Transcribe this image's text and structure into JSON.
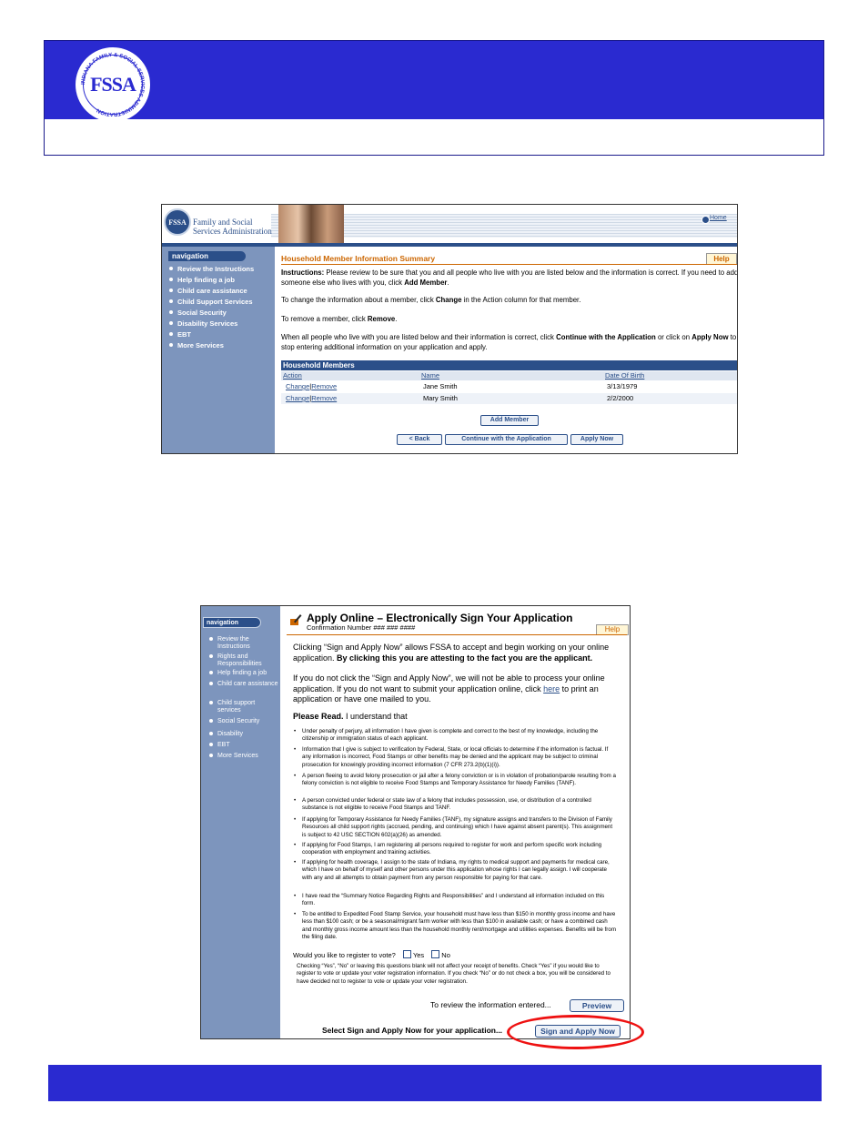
{
  "header": {
    "seal_text": "FSSA",
    "seal_ring": "INDIANA FAMILY & SOCIAL SERVICES ADMINISTRATION"
  },
  "screen1": {
    "org_line1": "Family and Social",
    "org_line2": "Services Administration",
    "home": "Home",
    "nav_label": "navigation",
    "nav_items": [
      "Review the Instructions",
      "Help finding a job",
      "Child care assistance",
      "Child Support Services",
      "Social Security",
      "Disability Services",
      "EBT",
      "More Services"
    ],
    "page_title": "Household Member Information Summary",
    "help": "Help",
    "instr_label": "Instructions:",
    "instr_text": " Please review to be sure that you and all people who live with you are listed below and the information is correct. If you need to add someone else who lives with you, click ",
    "instr_bold": "Add Member",
    "change_pre": "To change the information about a member, click ",
    "change_bold": "Change",
    "change_post": " in the Action column for that member.",
    "remove_pre": "To remove a member, click ",
    "remove_bold": "Remove",
    "continue_pre": "When all people who live with you are listed below and their information is correct, click ",
    "continue_bold": "Continue with the Application",
    "continue_mid": " or click on ",
    "continue_bold2": "Apply Now",
    "continue_post": " to stop entering additional information on your application and apply.",
    "table_title": "Household Members",
    "columns": [
      "Action",
      "Name",
      "Date Of Birth"
    ],
    "rows": [
      {
        "change": "Change",
        "remove": "Remove",
        "name": "Jane Smith",
        "dob": "3/13/1979"
      },
      {
        "change": "Change",
        "remove": "Remove",
        "name": "Mary Smith",
        "dob": "2/2/2000"
      }
    ],
    "add_member": "Add Member",
    "back": "< Back",
    "continue_btn": "Continue with the Application",
    "apply_now": "Apply Now"
  },
  "screen2": {
    "nav_label": "navigation",
    "nav_items": [
      "Review the Instructions",
      "Rights and Responsibilities",
      "Help finding a job",
      "Child care assistance",
      "Child support services",
      "Social Security",
      "Disability",
      "EBT",
      "More Services"
    ],
    "title": "Apply Online – Electronically Sign Your Application",
    "confirmation": "Confirmation Number ### ### ####",
    "help": "Help",
    "p1_pre": "Clicking “Sign and Apply Now” allows FSSA to accept and begin working on your online application.",
    "p1_bold": " By clicking this you are attesting to the fact you are the applicant.",
    "p2_pre": "If you do not click the “Sign and Apply Now”, we will not be able to process your online application.  If you do not want to submit your application online, click ",
    "p2_link": "here",
    "p2_post": " to print an application or have one mailed to you.",
    "please_bold": "Please Read.",
    "please_post": "  I understand that",
    "bullets": [
      "Under penalty of perjury, all information I have given is complete and correct to the best of my knowledge, including the citizenship or immigration status of each applicant.",
      "Information that I give is subject to verification by Federal, State, or local officials to determine if the information is factual. If any information is incorrect, Food Stamps or other benefits may be denied and the applicant may be subject to criminal prosecution for knowingly providing incorrect information (7 CFR 273.2(b)(1)(i)).",
      "A person fleeing to avoid felony prosecution or jail after a felony conviction or is in violation of probation/parole resulting from a felony conviction is not eligible to receive Food Stamps and Temporary Assistance for Needy Families (TANF).",
      "A person convicted under federal or state law of a felony that includes possession, use, or distribution of a controlled substance is not eligible to receive Food Stamps and TANF.",
      "If applying for Temporary Assistance for Needy Families (TANF), my signature assigns and transfers to the Division of Family Resources all child support rights (accrued, pending, and continuing) which I have against absent parent(s). This assignment is subject to 42 USC SECTION 602(a)(26) as amended.",
      "If applying for Food Stamps, I am registering all persons required to register for work and perform specific work including cooperation with employment and training activities.",
      "If applying for health coverage, I assign to the state of Indiana, my rights to medical support and payments for medical care, which I have on behalf of myself and other persons under this application whose rights I can legally assign. I will cooperate with any and all attempts to obtain payment from any person responsible for paying for that care.",
      "I have read the “Summary Notice Regarding Rights and Responsibilities” and I understand all information included on this form.",
      "To be entitled to Expedited Food Stamp Service, your household must have less than $150 in monthly gross income and have less than $100 cash; or be a seasonal/migrant farm worker with less than $100 in available cash; or have a combined cash and monthly gross income amount less than the household monthly rent/mortgage and utilities expenses. Benefits will be from the filing date."
    ],
    "vote_q": "Would you like to register to vote?",
    "yes": "Yes",
    "no": "No",
    "vote_note": "Checking “Yes”, “No” or leaving this questions blank will not affect your receipt of benefits.  Check “Yes” if you would like to register to vote or update your voter registration information.  If you check “No” or do not check a box, you will be considered to have decided not to register to vote or update your voter registration.",
    "review_text": "To review the information entered...",
    "preview": "Preview",
    "select_text": "Select Sign and Apply Now for your application...",
    "sign_apply": "Sign and Apply Now"
  },
  "colors": {
    "header_blue": "#2a2ad0",
    "nav_blue": "#7d95bd",
    "accent_orange": "#cc6600",
    "highlight_red": "#e11111"
  }
}
